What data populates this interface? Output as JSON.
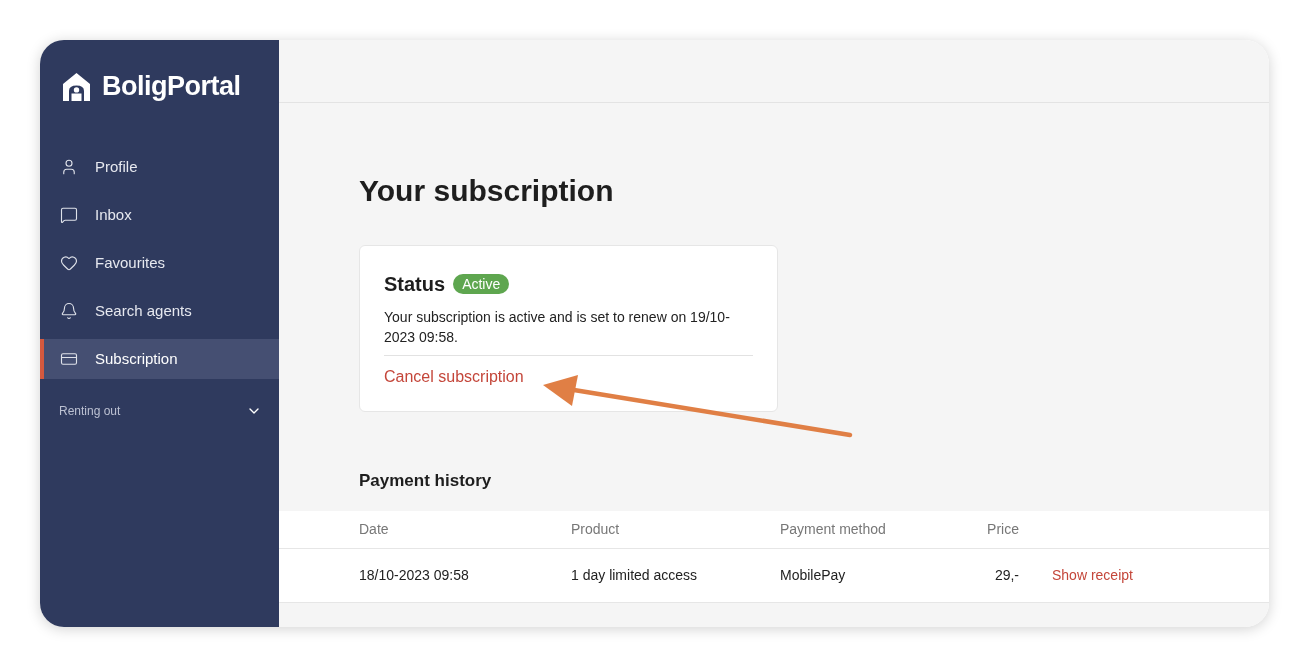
{
  "sidebar": {
    "logo": "BoligPortal",
    "items": [
      {
        "label": "Profile",
        "selected": false
      },
      {
        "label": "Inbox",
        "selected": false
      },
      {
        "label": "Favourites",
        "selected": false
      },
      {
        "label": "Search agents",
        "selected": false
      },
      {
        "label": "Subscription",
        "selected": true
      }
    ],
    "section": {
      "label": "Renting out",
      "expanded": false
    }
  },
  "main": {
    "title": "Your subscription",
    "status_card": {
      "heading": "Status",
      "badge": "Active",
      "description": "Your subscription is active and is set to renew on 19/10-2023 09:58.",
      "action": "Cancel subscription"
    },
    "payment_history": {
      "title": "Payment history",
      "columns": [
        "Date",
        "Product",
        "Payment method",
        "Price"
      ],
      "rows": [
        {
          "cells": [
            "18/10-2023 09:58",
            "1 day limited access",
            "MobilePay",
            "29,-"
          ],
          "action": "Show receipt"
        }
      ]
    }
  }
}
